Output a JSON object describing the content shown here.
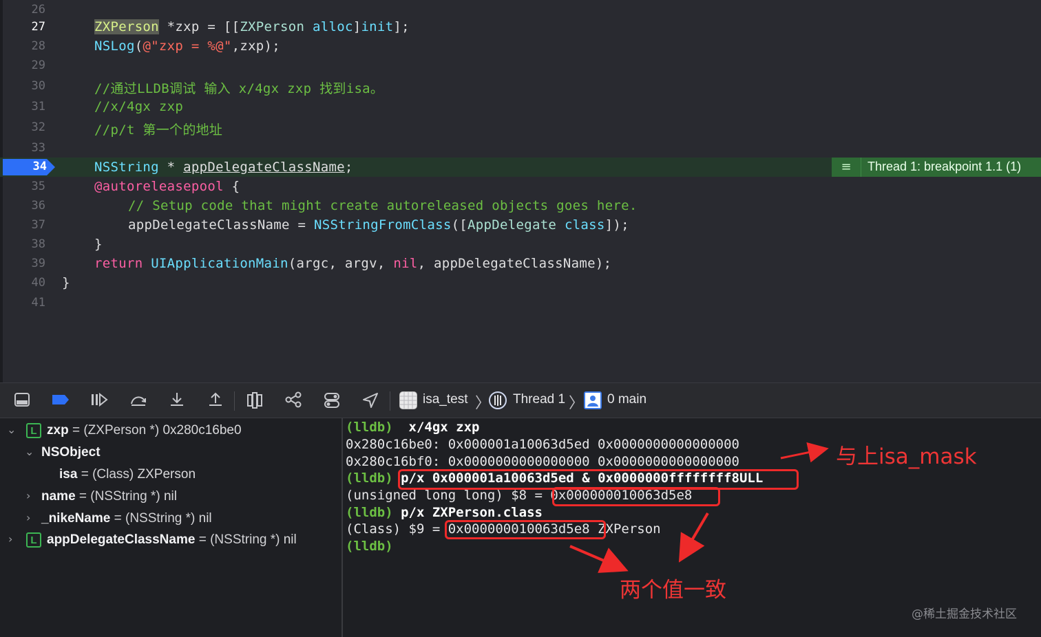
{
  "editor": {
    "line_numbers": [
      "26",
      "27",
      "28",
      "29",
      "30",
      "31",
      "32",
      "33",
      "34",
      "35",
      "36",
      "37",
      "38",
      "39",
      "40",
      "41"
    ],
    "line27": {
      "cls": "ZXPerson",
      "mid": " *zxp = [[",
      "cls2": "ZXPerson",
      "sp": " ",
      "alloc": "alloc",
      "close": "]",
      "init": "init",
      "end": "];"
    },
    "line28": {
      "fn": "NSLog",
      "open": "(",
      "str": "@\"zxp = %@\"",
      "rest": ",zxp);"
    },
    "line30": "//通过LLDB调试 输入 x/4gx zxp 找到isa。",
    "line31": "//x/4gx zxp",
    "line32": "//p/t 第一个的地址",
    "line34": {
      "cls": "NSString",
      "star": " * ",
      "var": "appDelegateClassName",
      "end": ";"
    },
    "line35": {
      "kw": "@autoreleasepool",
      "rest": " {"
    },
    "line36": "// Setup code that might create autoreleased objects goes here.",
    "line37": {
      "var": "appDelegateClassName = ",
      "fn": "NSStringFromClass",
      "open": "([",
      "cls": "AppDelegate",
      "sp": " ",
      "kw": "class",
      "end": "]);"
    },
    "line38": "}",
    "line39": {
      "kw": "return",
      "sp": " ",
      "fn": "UIApplicationMain",
      "args": "(argc, argv, ",
      "nil": "nil",
      "end": ", appDelegateClassName);"
    },
    "line40": "}",
    "breakpoint_label": "Thread 1: breakpoint 1.1 (1)"
  },
  "debugbar": {
    "target": "isa_test",
    "thread": "Thread 1",
    "frame": "0 main"
  },
  "variables": [
    {
      "name": "zxp",
      "type": "(ZXPerson *)",
      "value": "0x280c16be0"
    },
    {
      "name": "NSObject"
    },
    {
      "name": "isa",
      "type": "(Class)",
      "value": "ZXPerson"
    },
    {
      "name": "name",
      "type": "(NSString *)",
      "value": "nil"
    },
    {
      "name": "_nikeName",
      "type": "(NSString *)",
      "value": "nil"
    },
    {
      "name": "appDelegateClassName",
      "type": "(NSString *)",
      "value": "nil"
    }
  ],
  "var_badge": "L",
  "var_eq": " = ",
  "console": {
    "prompt": "(lldb)",
    "cmd1": "x/4gx zxp",
    "out1": "0x280c16be0: 0x000001a10063d5ed 0x0000000000000000",
    "out2": "0x280c16bf0: 0x0000000000000000 0x0000000000000000",
    "cmd2": "p/x 0x000001a10063d5ed & 0x0000000ffffffff8ULL",
    "out3_prefix": "(unsigned long long) $8 = ",
    "out3_value": "0x000000010063d5e8",
    "cmd3": "p/x ZXPerson.class",
    "out4_prefix": "(Class) $9 = ",
    "out4_value": "0x000000010063d5e8",
    "out4_suffix": " ZXPerson"
  },
  "annotations": {
    "mask_label": "与上isa_mask",
    "equal_label": "两个值一致",
    "color": "#ee2a2a"
  },
  "watermark": "@稀土掘金技术社区"
}
